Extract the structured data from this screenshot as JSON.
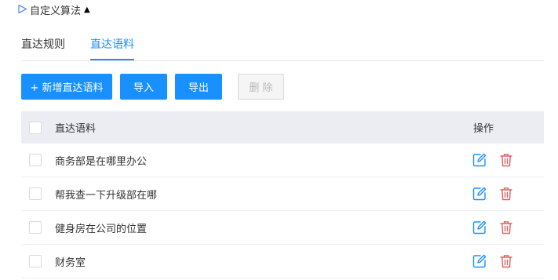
{
  "section": {
    "title": "自定义算法",
    "caret": "▲"
  },
  "tabs": [
    {
      "label": "直达规则",
      "active": false
    },
    {
      "label": "直达语料",
      "active": true
    }
  ],
  "toolbar": {
    "add_label": "+ 新增直达语料",
    "import_label": "导入",
    "export_label": "导出",
    "delete_label": "删 除"
  },
  "table": {
    "columns": {
      "corpus": "直达语料",
      "action": "操作"
    },
    "rows": [
      {
        "text": "商务部是在哪里办公"
      },
      {
        "text": "帮我查一下升级部在哪"
      },
      {
        "text": "健身房在公司的位置"
      },
      {
        "text": "财务室"
      }
    ]
  },
  "colors": {
    "accent": "#1890ff",
    "delete_icon": "#e35f5f",
    "header_bg": "#ebedf2"
  },
  "icons": [
    "play-triangle-icon",
    "caret-up-icon",
    "edit-icon",
    "trash-icon"
  ]
}
